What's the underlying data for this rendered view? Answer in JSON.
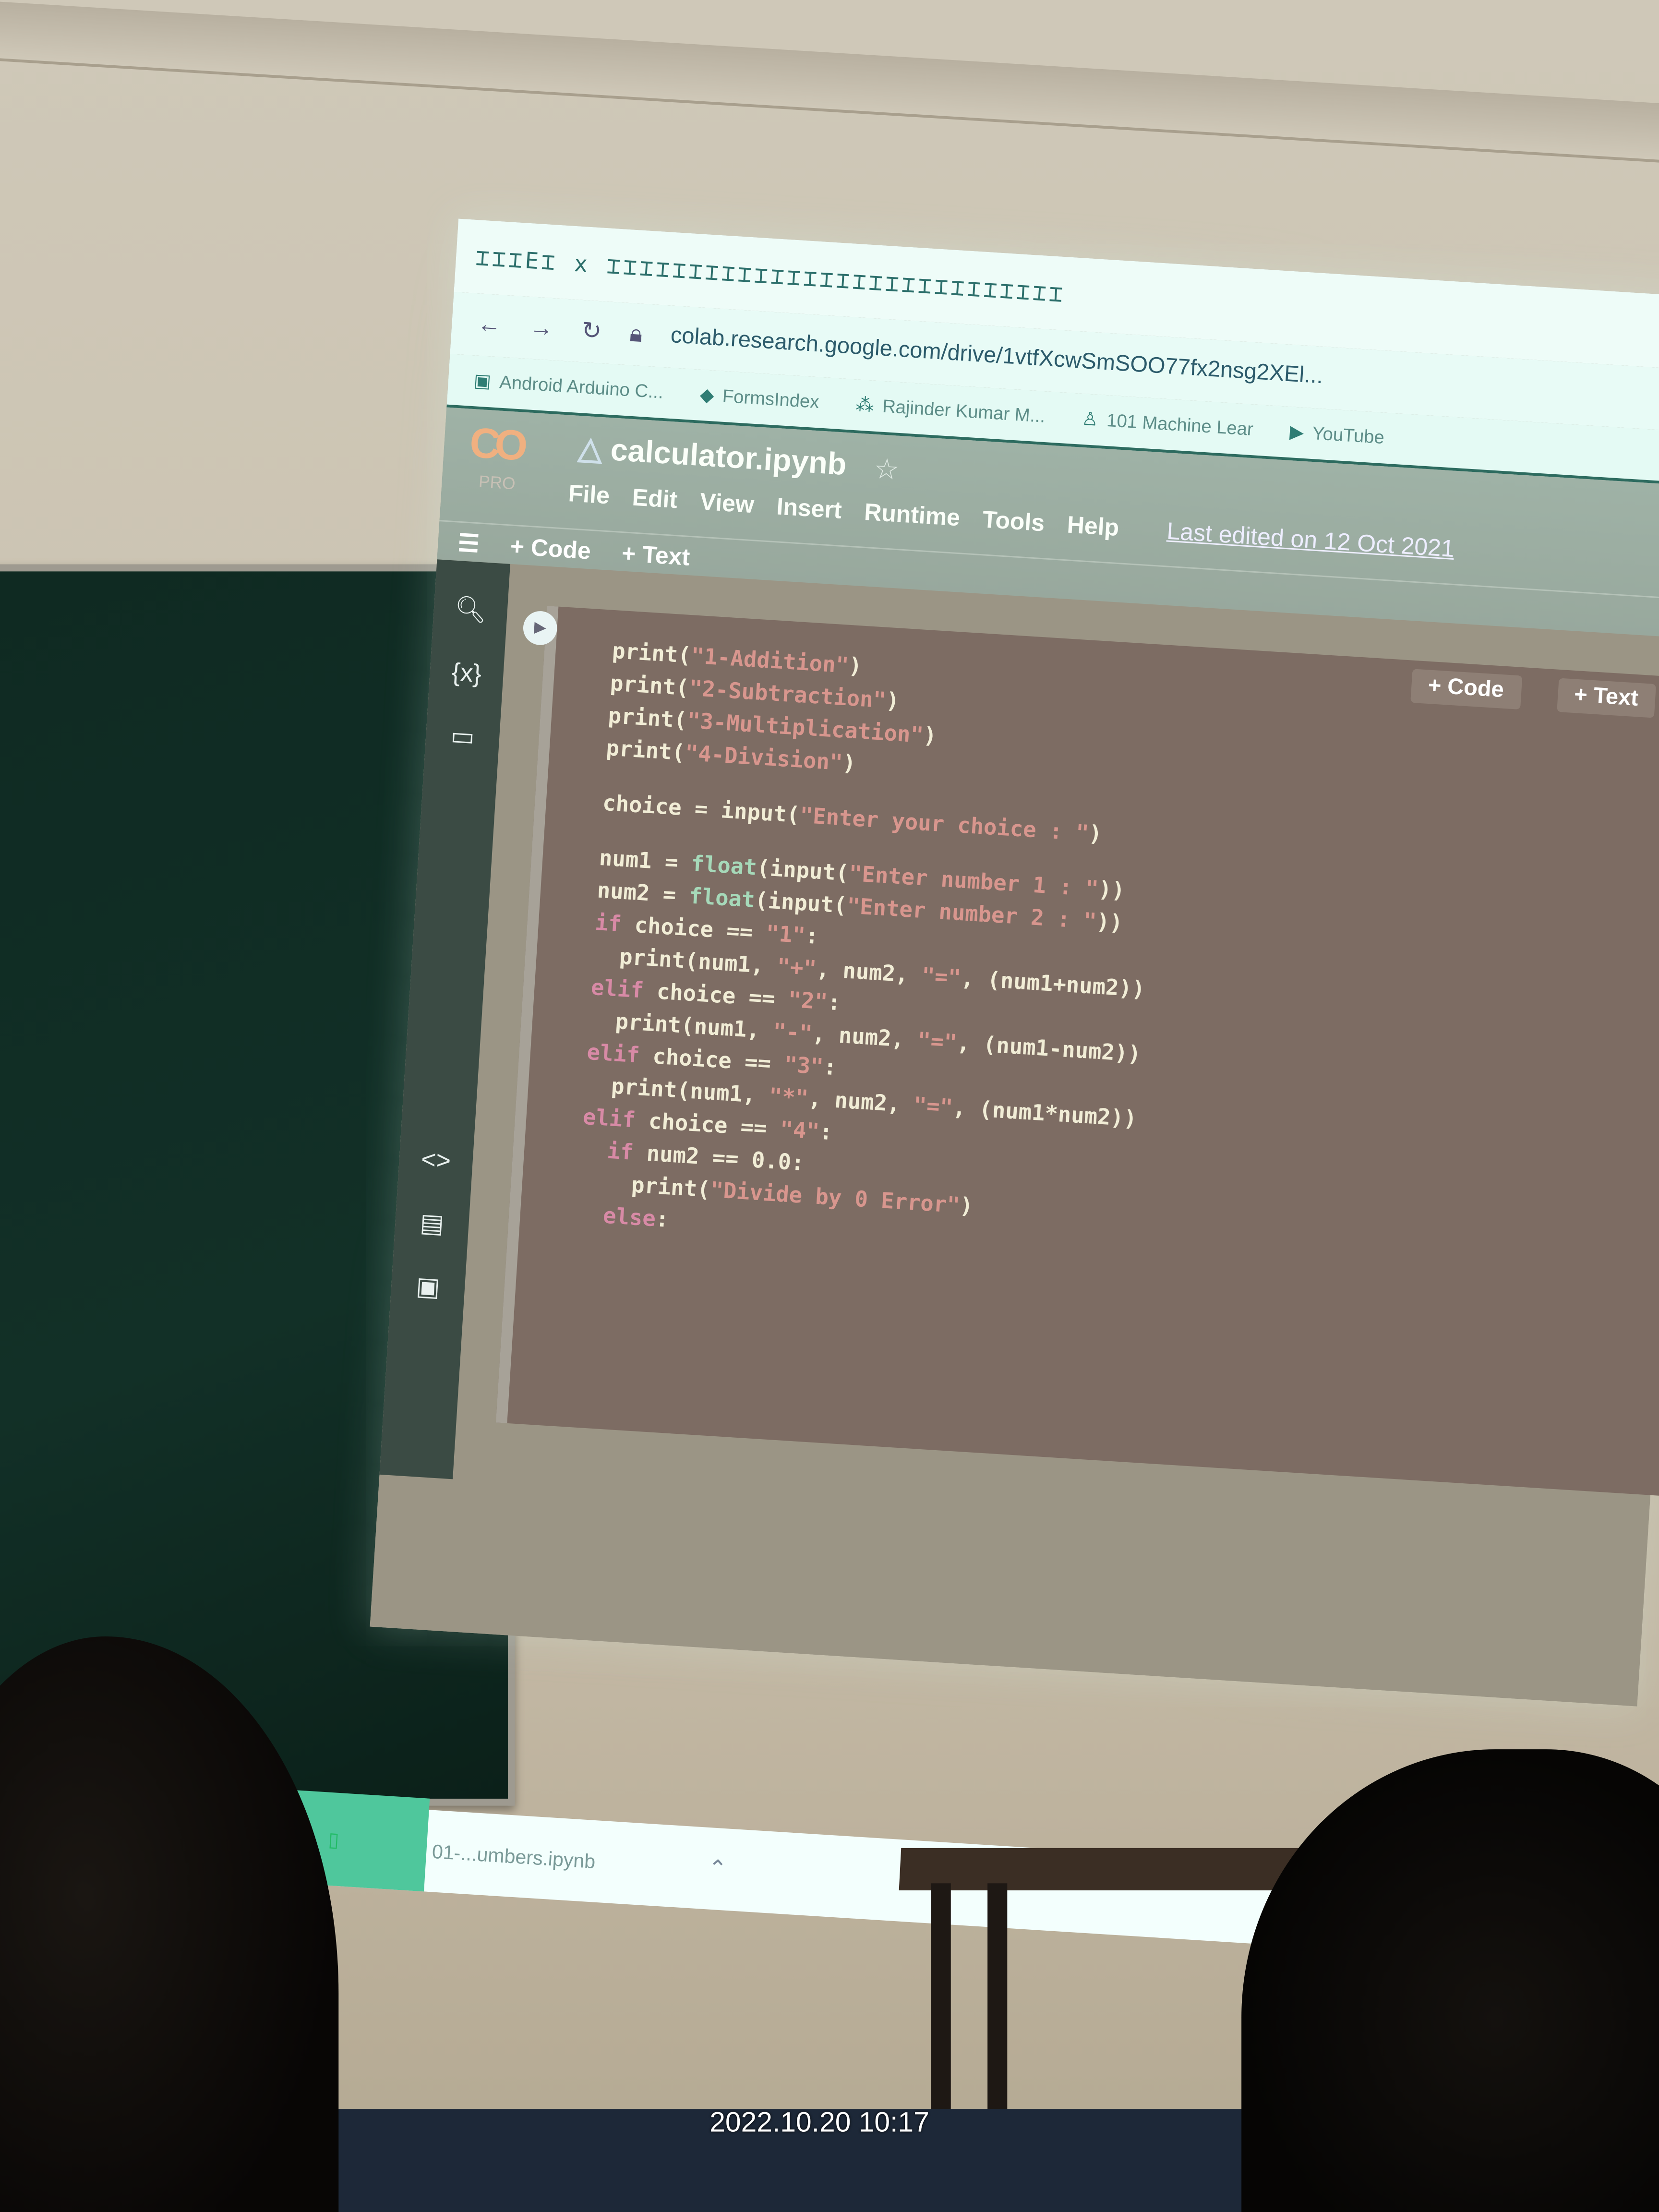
{
  "browser": {
    "tab_strip_glyphs": "⌶⌶⌶E⌶ x ⌶⌶⌶⌶⌶⌶⌶⌶⌶⌶⌶⌶⌶⌶⌶⌶⌶⌶⌶⌶⌶⌶⌶⌶⌶⌶⌶⌶",
    "url": "colab.research.google.com/drive/1vtfXcwSmSOO77fx2nsg2XEl...",
    "bookmarks": [
      "Android Arduino C...",
      "FormsIndex",
      "Rajinder Kumar M...",
      "101 Machine Lear",
      "YouTube"
    ]
  },
  "colab": {
    "logo": "CO",
    "logo_badge": "PRO",
    "title": "calculator.ipynb",
    "menu": [
      "File",
      "Edit",
      "View",
      "Insert",
      "Runtime",
      "Tools",
      "Help"
    ],
    "last_edited": "Last edited on 12 Oct 2021",
    "toolbar": {
      "code": "+ Code",
      "text": "+ Text"
    },
    "cell_buttons": {
      "code": "+ Code",
      "text": "+ Text"
    }
  },
  "code_lines": [
    [
      [
        "tx",
        "print("
      ],
      [
        "str",
        "\"1-Addition\""
      ],
      [
        "tx",
        ")"
      ]
    ],
    [
      [
        "tx",
        "print("
      ],
      [
        "str",
        "\"2-Subtraction\""
      ],
      [
        "tx",
        ")"
      ]
    ],
    [
      [
        "tx",
        "print("
      ],
      [
        "str",
        "\"3-Multiplication\""
      ],
      [
        "tx",
        ")"
      ]
    ],
    [
      [
        "tx",
        "print("
      ],
      [
        "str",
        "\"4-Division\""
      ],
      [
        "tx",
        ")"
      ]
    ],
    [],
    [
      [
        "tx",
        "choice = input("
      ],
      [
        "str",
        "\"Enter your choice : \""
      ],
      [
        "tx",
        ")"
      ]
    ],
    [],
    [
      [
        "tx",
        "num1 = "
      ],
      [
        "fn",
        "float"
      ],
      [
        "tx",
        "(input("
      ],
      [
        "str",
        "\"Enter number 1 : \""
      ],
      [
        "tx",
        "))"
      ]
    ],
    [
      [
        "tx",
        "num2 = "
      ],
      [
        "fn",
        "float"
      ],
      [
        "tx",
        "(input("
      ],
      [
        "str",
        "\"Enter number 2 : \""
      ],
      [
        "tx",
        "))"
      ]
    ],
    [
      [
        "kw",
        "if"
      ],
      [
        "tx",
        " choice == "
      ],
      [
        "str",
        "\"1\""
      ],
      [
        "tx",
        ":"
      ]
    ],
    [
      [
        "tx",
        "  print(num1, "
      ],
      [
        "str",
        "\"+\""
      ],
      [
        "tx",
        ", num2, "
      ],
      [
        "str",
        "\"=\""
      ],
      [
        "tx",
        ", (num1+num2))"
      ]
    ],
    [
      [
        "kw",
        "elif"
      ],
      [
        "tx",
        " choice == "
      ],
      [
        "str",
        "\"2\""
      ],
      [
        "tx",
        ":"
      ]
    ],
    [
      [
        "tx",
        "  print(num1, "
      ],
      [
        "str",
        "\"-\""
      ],
      [
        "tx",
        ", num2, "
      ],
      [
        "str",
        "\"=\""
      ],
      [
        "tx",
        ", (num1-num2))"
      ]
    ],
    [
      [
        "kw",
        "elif"
      ],
      [
        "tx",
        " choice == "
      ],
      [
        "str",
        "\"3\""
      ],
      [
        "tx",
        ":"
      ]
    ],
    [
      [
        "tx",
        "  print(num1, "
      ],
      [
        "str",
        "\"*\""
      ],
      [
        "tx",
        ", num2, "
      ],
      [
        "str",
        "\"=\""
      ],
      [
        "tx",
        ", (num1*num2))"
      ]
    ],
    [
      [
        "kw",
        "elif"
      ],
      [
        "tx",
        " choice == "
      ],
      [
        "str",
        "\"4\""
      ],
      [
        "tx",
        ":"
      ]
    ],
    [
      [
        "tx",
        "  "
      ],
      [
        "kw",
        "if"
      ],
      [
        "tx",
        " num2 == 0.0:"
      ]
    ],
    [
      [
        "tx",
        "    print("
      ],
      [
        "str",
        "\"Divide by 0 Error\""
      ],
      [
        "tx",
        ")"
      ]
    ],
    [
      [
        "kw",
        "  else"
      ],
      [
        "tx",
        ":"
      ]
    ]
  ],
  "download_bar": {
    "file": "01-...umbers.ipynb"
  },
  "photo_timestamp": "2022.10.20 10:17"
}
